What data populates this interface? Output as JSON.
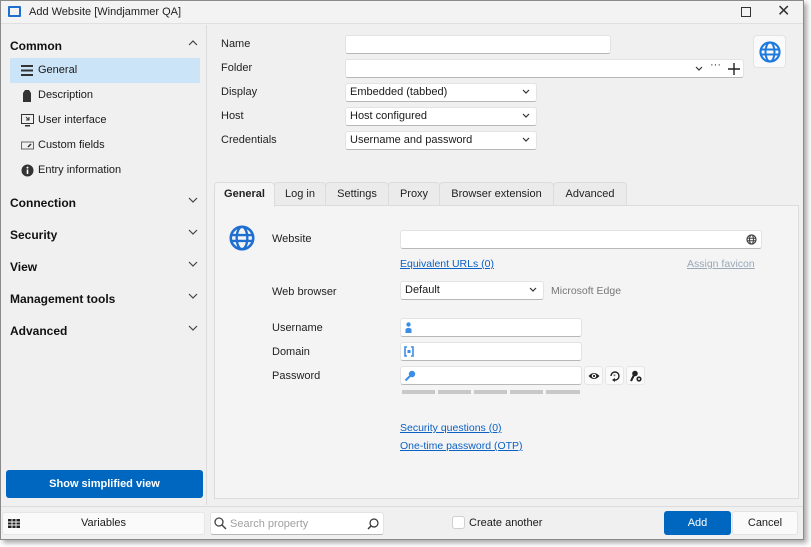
{
  "window": {
    "title": "Add Website [Windjammer QA]",
    "maximize_icon": "maximize-icon",
    "close_icon": "close-icon"
  },
  "sidebar": {
    "sections": [
      {
        "label": "Common",
        "expanded": true,
        "icon": "chevron-up-icon"
      },
      {
        "label": "Connection",
        "expanded": false,
        "icon": "chevron-down-icon"
      },
      {
        "label": "Security",
        "expanded": false,
        "icon": "chevron-down-icon"
      },
      {
        "label": "View",
        "expanded": false,
        "icon": "chevron-down-icon"
      },
      {
        "label": "Management tools",
        "expanded": false,
        "icon": "chevron-down-icon"
      },
      {
        "label": "Advanced",
        "expanded": false,
        "icon": "chevron-down-icon"
      }
    ],
    "items": [
      {
        "label": "General",
        "icon": "list-icon",
        "selected": true
      },
      {
        "label": "Description",
        "icon": "tag-icon",
        "selected": false
      },
      {
        "label": "User interface",
        "icon": "monitor-icon",
        "selected": false
      },
      {
        "label": "Custom fields",
        "icon": "custom-field-icon",
        "selected": false
      },
      {
        "label": "Entry information",
        "icon": "info-icon",
        "selected": false
      }
    ],
    "simplified_view_label": "Show simplified view"
  },
  "form": {
    "name_label": "Name",
    "name_value": "",
    "folder_label": "Folder",
    "folder_value": "",
    "display_label": "Display",
    "display_value": "Embedded (tabbed)",
    "host_label": "Host",
    "host_value": "Host configured",
    "credentials_label": "Credentials",
    "credentials_value": "Username and password",
    "entry_icon": "globe-icon"
  },
  "tabs": [
    {
      "label": "General",
      "active": true
    },
    {
      "label": "Log in",
      "active": false
    },
    {
      "label": "Settings",
      "active": false
    },
    {
      "label": "Proxy",
      "active": false
    },
    {
      "label": "Browser extension",
      "active": false
    },
    {
      "label": "Advanced",
      "active": false
    }
  ],
  "general_tab": {
    "website_label": "Website",
    "website_value": "",
    "equivalent_urls_link": "Equivalent URLs (0)",
    "assign_favicon_link": "Assign favicon",
    "web_browser_label": "Web browser",
    "web_browser_value": "Default",
    "web_browser_hint": "Microsoft Edge",
    "username_label": "Username",
    "username_value": "",
    "domain_label": "Domain",
    "domain_value": "",
    "password_label": "Password",
    "password_value": "",
    "password_strength": 0,
    "security_questions_link": "Security questions (0)",
    "otp_link": "One-time password (OTP)"
  },
  "footer": {
    "variables_label": "Variables",
    "search_placeholder": "Search property",
    "create_another_label": "Create another",
    "create_another_checked": false,
    "add_label": "Add",
    "cancel_label": "Cancel"
  },
  "colors": {
    "accent": "#0067c0",
    "link": "#0b61c4",
    "selected_bg": "#cce4f7",
    "icon_blue": "#1f7ae0"
  }
}
